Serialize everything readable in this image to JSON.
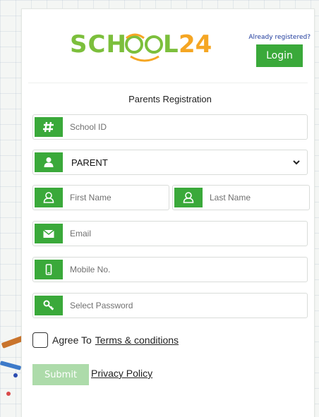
{
  "header": {
    "logo_text": "SCHOOL24",
    "already_registered": "Already registered?",
    "login_label": "Login"
  },
  "form": {
    "title": "Parents Registration",
    "school_id_placeholder": "School ID",
    "role_selected": "PARENT",
    "first_name_placeholder": "First Name",
    "last_name_placeholder": "Last Name",
    "email_placeholder": "Email",
    "mobile_placeholder": "Mobile No.",
    "password_placeholder": "Select Password",
    "agree_text": "Agree To",
    "terms_label": "Terms & conditions",
    "submit_label": "Submit",
    "privacy_label": "Privacy Policy"
  },
  "colors": {
    "accent": "#3aa93a",
    "submit_disabled": "#9fd59c",
    "link_blue": "#1e3a9c",
    "logo_green": "#7cbf3c",
    "logo_orange": "#f5a623"
  },
  "icons": {
    "school_id": "hash-icon",
    "role": "user-icon",
    "first_name": "user-outline-icon",
    "last_name": "user-outline-icon",
    "email": "envelope-icon",
    "mobile": "mobile-icon",
    "password": "key-icon",
    "select": "chevron-down-icon"
  }
}
